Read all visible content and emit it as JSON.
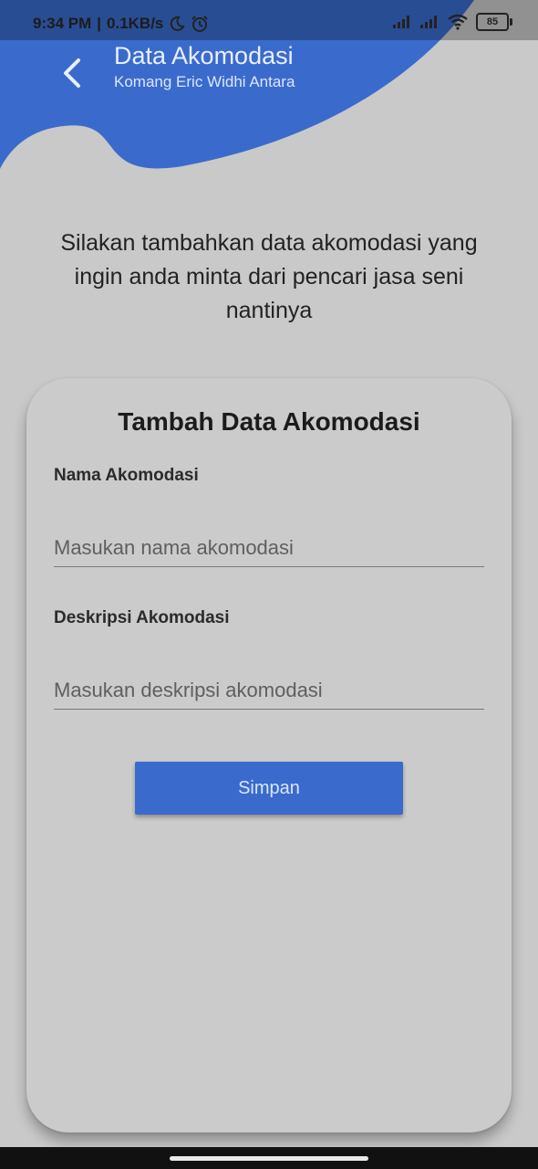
{
  "status_bar": {
    "time": "9:34 PM",
    "speed": "0.1KB/s",
    "battery": "85",
    "icons": [
      "moon-icon",
      "alarm-icon",
      "signal-icon",
      "signal-icon",
      "wifi-icon",
      "battery-icon"
    ]
  },
  "header": {
    "title": "Data Akomodasi",
    "subtitle": "Komang Eric Widhi Antara",
    "back_icon": "chevron-left-icon"
  },
  "intro_text": "Silakan tambahkan data akomodasi yang ingin anda minta dari pencari jasa seni nantinya",
  "form": {
    "title": "Tambah Data Akomodasi",
    "name_label": "Nama Akomodasi",
    "name_placeholder": "Masukan nama akomodasi",
    "desc_label": "Deskripsi Akomodasi",
    "desc_placeholder": "Masukan deskripsi akomodasi",
    "save_label": "Simpan"
  },
  "colors": {
    "primary": "#3a6bcc",
    "background": "#c9c9c9",
    "card": "#cbcbcb"
  }
}
